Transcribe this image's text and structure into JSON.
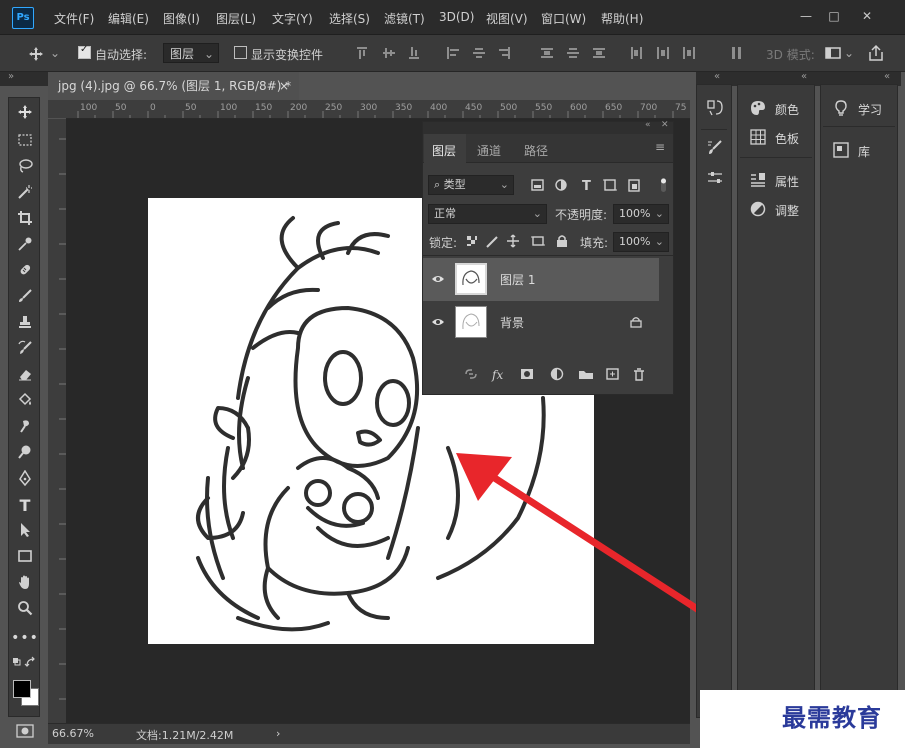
{
  "app": {
    "logo": "Ps"
  },
  "menu": [
    "文件(F)",
    "编辑(E)",
    "图像(I)",
    "图层(L)",
    "文字(Y)",
    "选择(S)",
    "滤镜(T)",
    "3D(D)",
    "视图(V)",
    "窗口(W)",
    "帮助(H)"
  ],
  "window_controls": {
    "minimize": "—",
    "maximize": "□",
    "close": "✕"
  },
  "options": {
    "auto_select_label": "自动选择:",
    "auto_select_checked": true,
    "auto_select_target": "图层",
    "show_transform_label": "显示变换控件",
    "mode_3d_label": "3D 模式:"
  },
  "document": {
    "tab_title": "jpg (4).jpg @ 66.7% (图层 1, RGB/8#) *",
    "close_glyph": "×",
    "ruler_ticks": [
      "100",
      "50",
      "0",
      "50",
      "100",
      "150",
      "200",
      "250",
      "300",
      "350",
      "400",
      "450",
      "500",
      "550",
      "600",
      "650",
      "700",
      "75"
    ],
    "zoom": "66.67%",
    "doc_size": "文档:1.21M/2.42M",
    "status_arrow": "›"
  },
  "layers_panel": {
    "tabs": [
      "图层",
      "通道",
      "路径"
    ],
    "filter_type": "类型",
    "blend_mode": "正常",
    "opacity_label": "不透明度:",
    "opacity": "100%",
    "lock_label": "锁定:",
    "fill_label": "填充:",
    "fill": "100%",
    "layers": [
      {
        "name": "图层 1",
        "selected": true,
        "locked": false
      },
      {
        "name": "背景",
        "selected": false,
        "locked": true
      }
    ]
  },
  "right_panels": {
    "mid": [
      "颜色",
      "色板",
      "属性",
      "调整"
    ],
    "far": [
      "学习",
      "库"
    ]
  },
  "watermark": "最需教育",
  "colors": {
    "accent": "#31a8ff",
    "arrow": "#e8262b",
    "watermark": "#2a3a9a"
  }
}
